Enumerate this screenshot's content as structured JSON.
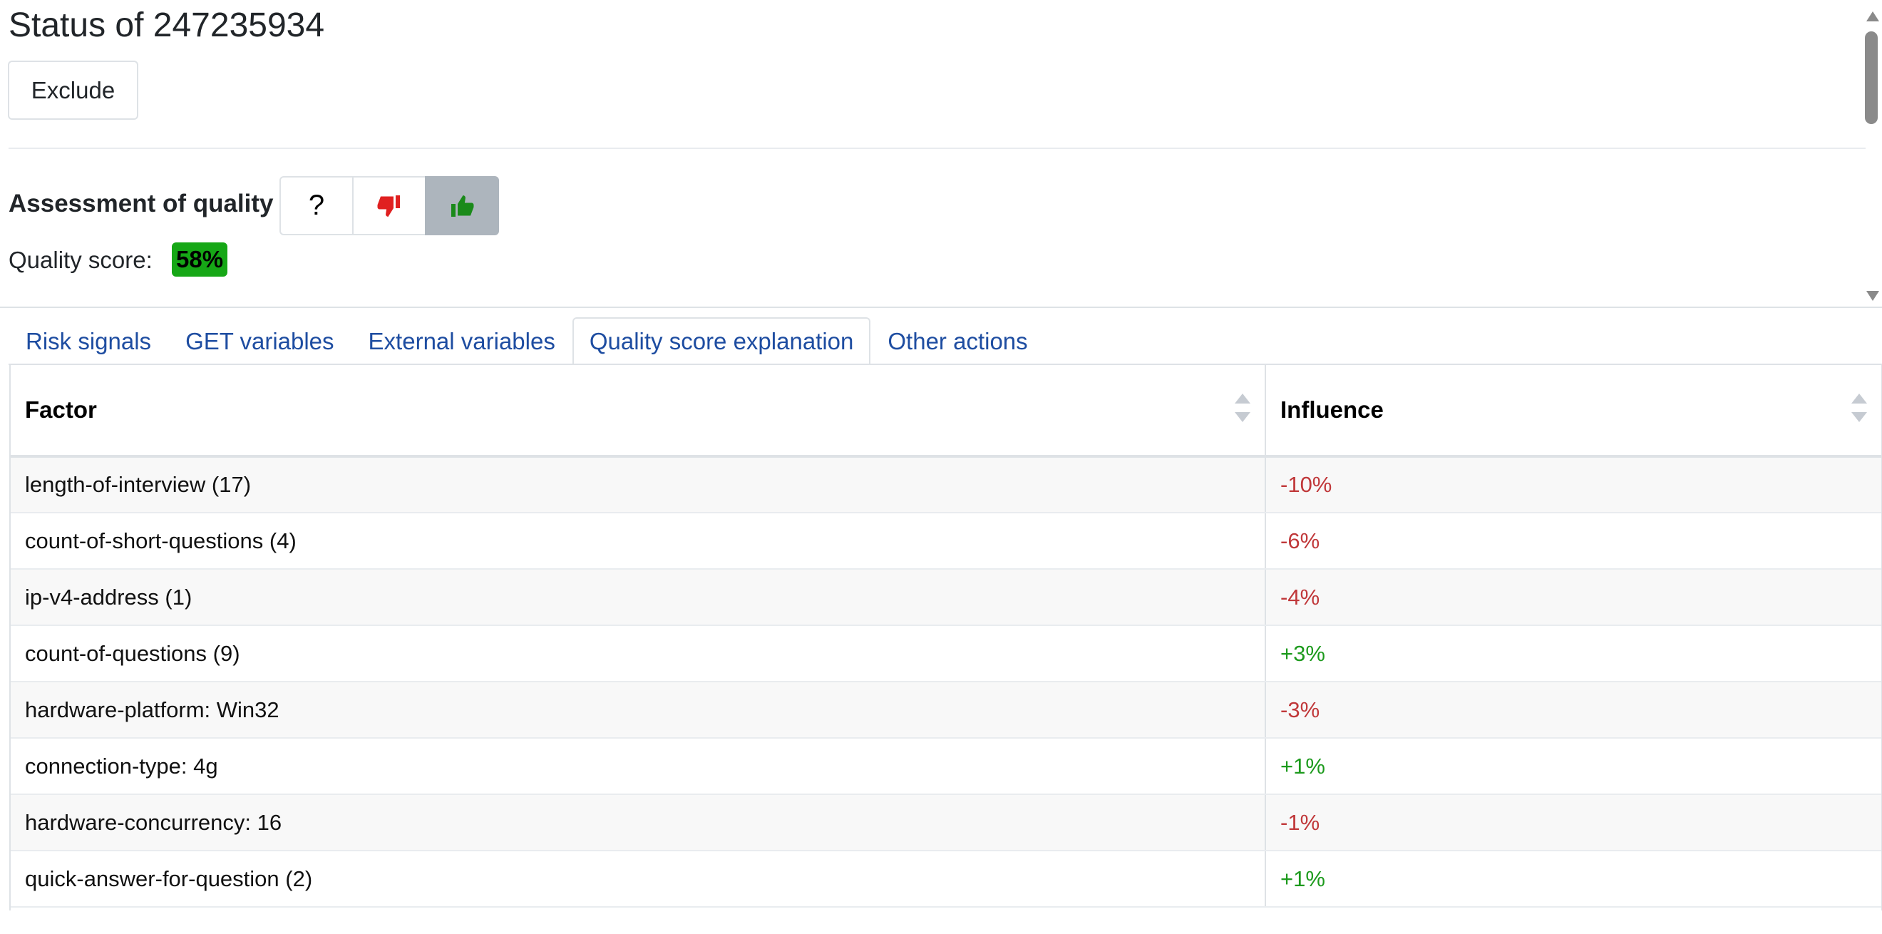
{
  "page": {
    "title": "Status of 247235934",
    "exclude_label": "Exclude"
  },
  "assessment": {
    "label": "Assessment of quality",
    "buttons": [
      {
        "label": "?",
        "icon": "question-mark"
      },
      {
        "label": "",
        "icon": "thumbs-down-icon",
        "color": "#e02020"
      },
      {
        "label": "",
        "icon": "thumbs-up-icon",
        "color": "#1a8a1a",
        "active": true
      }
    ],
    "score_label": "Quality score:",
    "score_value": "58%",
    "score_color": "#16a716"
  },
  "tabs": [
    {
      "label": "Risk signals",
      "active": false
    },
    {
      "label": "GET variables",
      "active": false
    },
    {
      "label": "External variables",
      "active": false
    },
    {
      "label": "Quality score explanation",
      "active": true
    },
    {
      "label": "Other actions",
      "active": false
    }
  ],
  "table": {
    "columns": [
      "Factor",
      "Influence"
    ],
    "rows": [
      {
        "factor": "length-of-interview (17)",
        "influence": "-10%"
      },
      {
        "factor": "count-of-short-questions (4)",
        "influence": "-6%"
      },
      {
        "factor": "ip-v4-address (1)",
        "influence": "-4%"
      },
      {
        "factor": "count-of-questions (9)",
        "influence": "+3%"
      },
      {
        "factor": "hardware-platform: Win32",
        "influence": "-3%"
      },
      {
        "factor": "connection-type: 4g",
        "influence": "+1%"
      },
      {
        "factor": "hardware-concurrency: 16",
        "influence": "-1%"
      },
      {
        "factor": "quick-answer-for-question (2)",
        "influence": "+1%"
      }
    ]
  },
  "colors": {
    "negative": "#c0383a",
    "positive": "#1c9a1c",
    "tab_link": "#1e4da1"
  }
}
